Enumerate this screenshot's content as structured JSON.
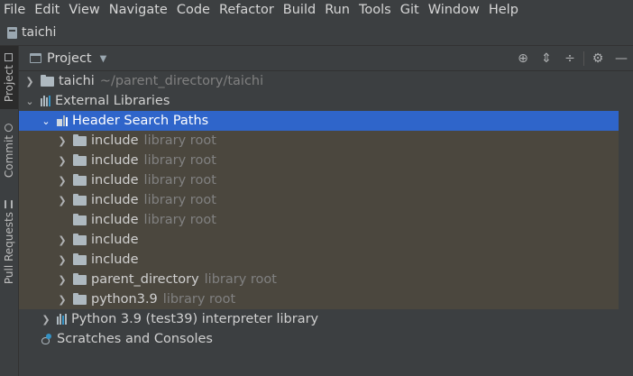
{
  "menu": [
    "File",
    "Edit",
    "View",
    "Navigate",
    "Code",
    "Refactor",
    "Build",
    "Run",
    "Tools",
    "Git",
    "Window",
    "Help"
  ],
  "window": {
    "title": "taichi"
  },
  "toolstrip": {
    "project": "Project",
    "commit": "Commit",
    "pull_requests": "Pull Requests"
  },
  "panel": {
    "title": "Project"
  },
  "tree": {
    "root_name": "taichi",
    "root_path": "~/parent_directory/taichi",
    "external_libraries": "External Libraries",
    "header_search_paths": "Header Search Paths",
    "children": [
      {
        "name": "include",
        "hint": "library root"
      },
      {
        "name": "include",
        "hint": "library root"
      },
      {
        "name": "include",
        "hint": "library root"
      },
      {
        "name": "include",
        "hint": "library root"
      },
      {
        "name": "include",
        "hint": "library root"
      },
      {
        "name": "include",
        "hint": ""
      },
      {
        "name": "include",
        "hint": ""
      },
      {
        "name": "parent_directory",
        "hint": "library root"
      },
      {
        "name": "python3.9",
        "hint": "library root"
      }
    ],
    "python_lib": "Python 3.9 (test39) interpreter library",
    "scratches": "Scratches and Consoles"
  }
}
